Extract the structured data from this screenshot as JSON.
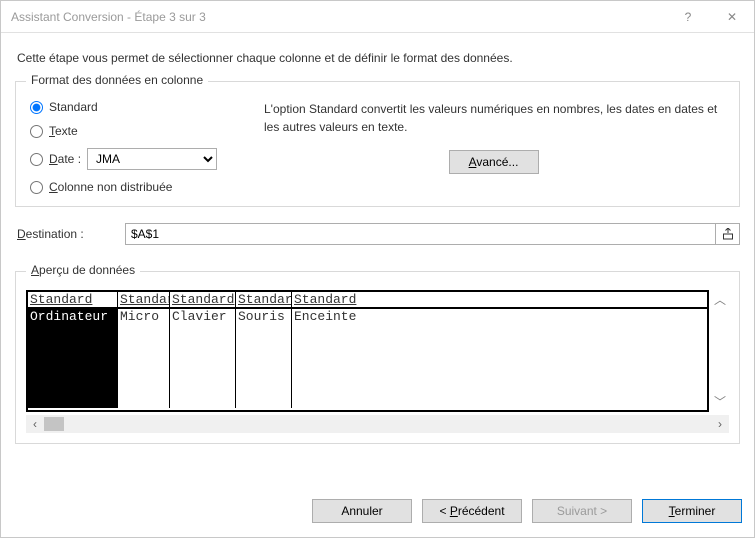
{
  "titlebar": {
    "title": "Assistant Conversion - Étape 3 sur 3",
    "help_icon": "?",
    "close_icon": "✕"
  },
  "intro": "Cette étape vous permet de sélectionner chaque colonne et de définir le format des données.",
  "format": {
    "legend": "Format des données en colonne",
    "standard_label": "Standard",
    "texte_pre": "T",
    "texte_rest": "exte",
    "date_pre": "D",
    "date_rest": "ate :",
    "date_value": "JMA",
    "colonne_pre": "C",
    "colonne_rest": "olonne non distribuée",
    "selected": "standard",
    "right_text": "L'option Standard convertit les valeurs numériques en nombres, les dates en dates et les autres valeurs en texte.",
    "advanced_pre": "A",
    "advanced_rest": "vancé..."
  },
  "destination": {
    "label_pre": "D",
    "label_rest": "estination :",
    "value": "$A$1"
  },
  "preview": {
    "legend_pre": "A",
    "legend_rest": "perçu de données",
    "headers": [
      "Standard",
      "Standard",
      "Standard",
      "Standard",
      "Standard"
    ],
    "row": [
      "Ordinateur",
      "Micro",
      "Clavier",
      "Souris",
      "Enceinte"
    ],
    "selected_col": 0
  },
  "footer": {
    "cancel": "Annuler",
    "prev_pre": "< ",
    "prev_accel": "P",
    "prev_rest": "récédent",
    "next_pre": "Suivant ",
    "next_rest": ">",
    "finish_pre": "T",
    "finish_rest": "erminer"
  }
}
